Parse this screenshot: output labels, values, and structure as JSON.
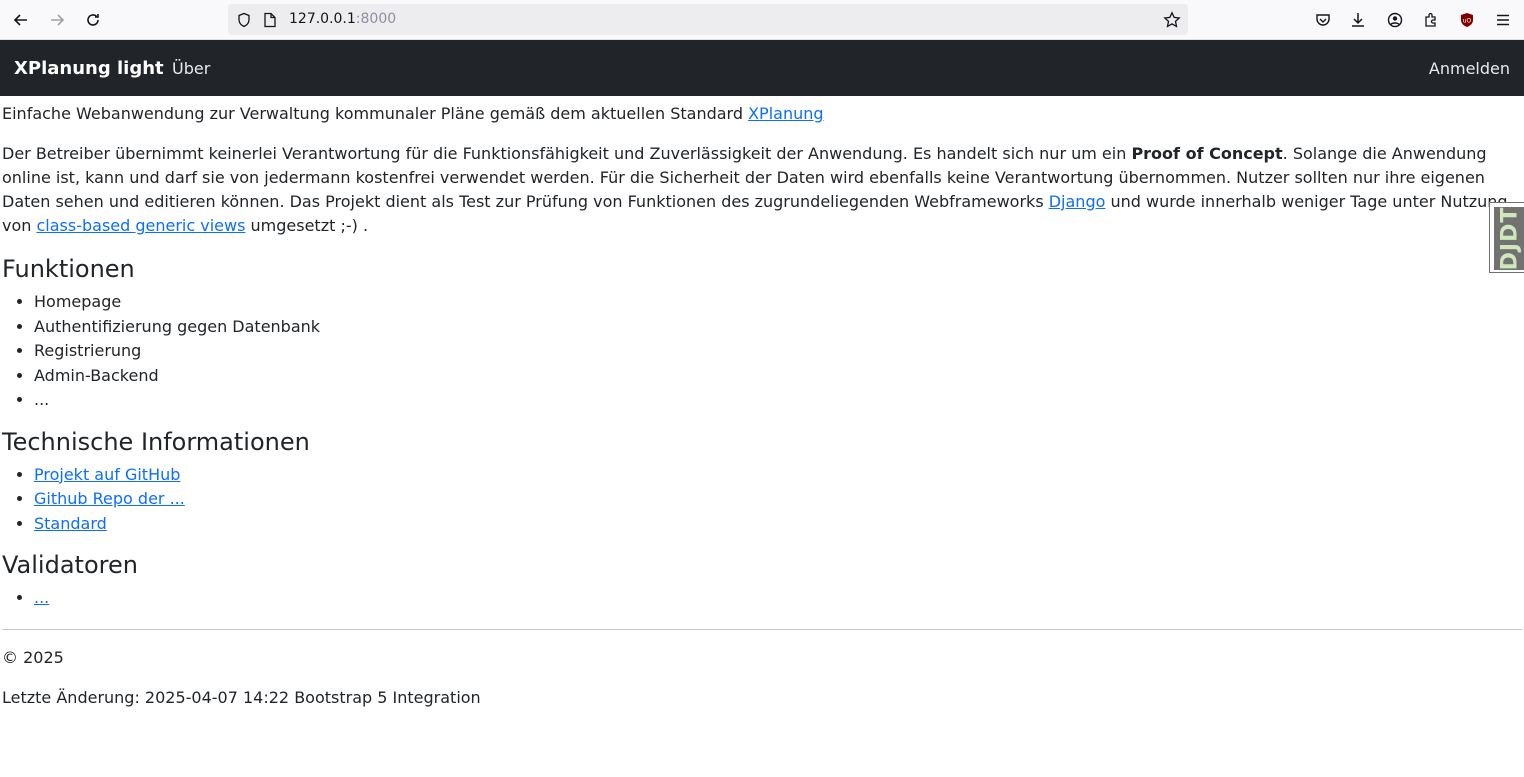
{
  "browser": {
    "url_host": "127.0.0.1",
    "url_port": ":8000",
    "icons": [
      "back-icon",
      "forward-icon",
      "reload-icon",
      "shield-icon",
      "page-icon",
      "star-icon",
      "pocket-icon",
      "download-icon",
      "account-icon",
      "extensions-icon",
      "ublock-icon",
      "menu-icon"
    ]
  },
  "navbar": {
    "brand": "XPlanung light",
    "about": "Über",
    "login": "Anmelden"
  },
  "intro": {
    "text": "Einfache Webanwendung zur Verwaltung kommunaler Pläne gemäß dem aktuellen Standard ",
    "link": "XPlanung"
  },
  "disclaimer": {
    "part1": "Der Betreiber übernimmt keinerlei Verantwortung für die Funktionsfähigkeit und Zuverlässigkeit der Anwendung. Es handelt sich nur um ein ",
    "bold": "Proof of Concept",
    "part2": ". Solange die Anwendung online ist, kann und darf sie von jedermann kostenfrei verwendet werden. Für die Sicherheit der Daten wird ebenfalls keine Verantwortung übernommen. Nutzer sollten nur ihre eigenen Daten sehen und editieren können. Das Projekt dient als Test zur Prüfung von Funktionen des zugrundeliegenden Webframeworks ",
    "link1": "Django",
    "part3": " und wurde innerhalb weniger Tage unter Nutzung von ",
    "link2": "class-based generic views",
    "part4": " umgesetzt ;-) ."
  },
  "sections": {
    "features": {
      "title": "Funktionen",
      "items": [
        "Homepage",
        "Authentifizierung gegen Datenbank",
        "Registrierung",
        "Admin-Backend",
        "..."
      ]
    },
    "tech": {
      "title": "Technische Informationen",
      "links": [
        "Projekt auf GitHub",
        "Github Repo der ...",
        "Standard"
      ]
    },
    "validators": {
      "title": "Validatoren",
      "links": [
        "..."
      ]
    }
  },
  "footer": {
    "copyright": "© 2025",
    "last_change": "Letzte Änderung: 2025-04-07 14:22 Bootstrap 5 Integration"
  },
  "debug_toolbar": {
    "label": "DJDT"
  }
}
